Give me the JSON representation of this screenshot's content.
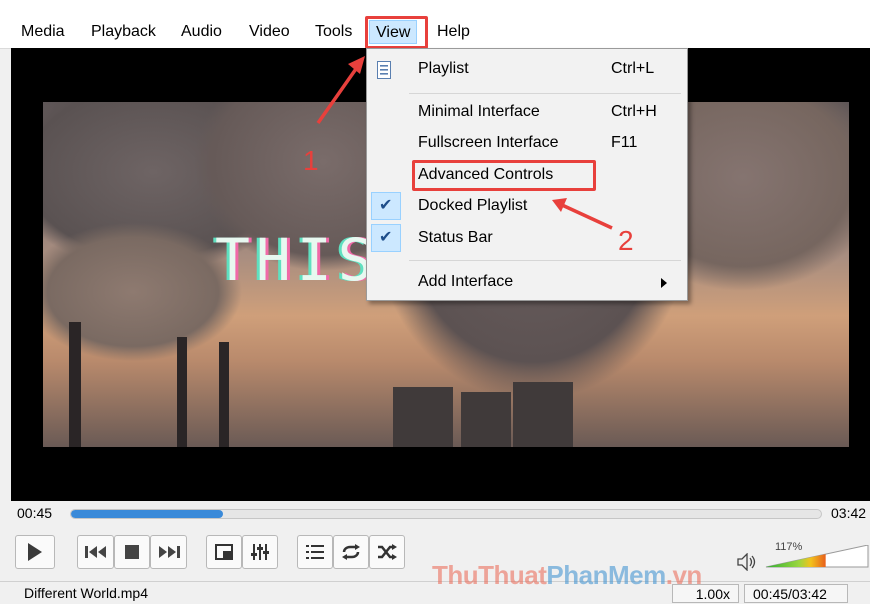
{
  "menu": {
    "items": [
      "Media",
      "Playback",
      "Audio",
      "Video",
      "Tools",
      "View",
      "Help"
    ],
    "active": "View"
  },
  "view_menu": {
    "items": [
      {
        "label": "Playlist",
        "shortcut": "Ctrl+L",
        "icon": "playlist-icon"
      },
      {
        "label": "Minimal Interface",
        "shortcut": "Ctrl+H"
      },
      {
        "label": "Fullscreen Interface",
        "shortcut": "F11"
      },
      {
        "label": "Advanced Controls",
        "shortcut": ""
      },
      {
        "label": "Docked Playlist",
        "shortcut": "",
        "checked": true
      },
      {
        "label": "Status Bar",
        "shortcut": "",
        "checked": true
      },
      {
        "label": "Add Interface",
        "shortcut": "",
        "submenu": true
      }
    ]
  },
  "annotations": {
    "step1": "1",
    "step2": "2"
  },
  "video": {
    "overlay_text": "THIS"
  },
  "player": {
    "elapsed": "00:45",
    "total": "03:42",
    "progress": 0.203,
    "volume_percent": "117%",
    "volume_level": 1.17
  },
  "controls": [
    "play-icon",
    "previous-icon",
    "stop-icon",
    "next-icon",
    "fullscreen-icon",
    "extended-settings-icon",
    "playlist-icon",
    "loop-icon",
    "shuffle-icon",
    "volume-icon"
  ],
  "status": {
    "filename": "Different World.mp4",
    "speed": "1.00x",
    "time": "00:45/03:42"
  },
  "watermark": {
    "part1": "ThuThuat",
    "part2": "PhanMem",
    "part3": ".vn"
  },
  "colors": {
    "accent": "#3a8ad9",
    "annotation": "#e8403c",
    "menu_highlight": "#cce8ff"
  }
}
